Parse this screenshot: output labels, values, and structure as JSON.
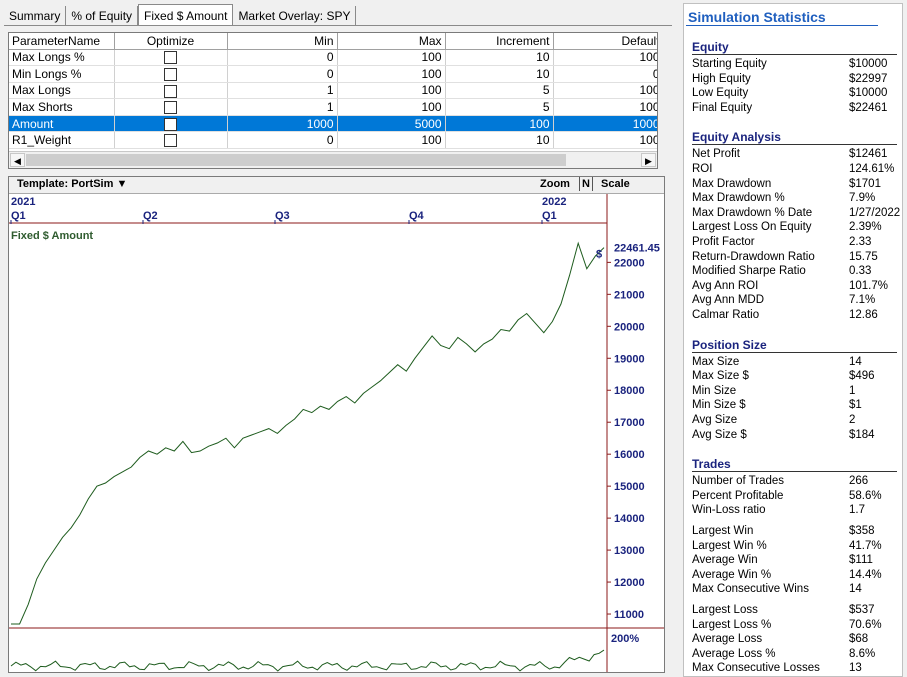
{
  "tabs": [
    "Summary",
    "% of Equity",
    "Fixed $ Amount",
    "Market Overlay: SPY"
  ],
  "active_tab": "Fixed $ Amount",
  "params": {
    "headers": [
      "ParameterName",
      "Optimize",
      "Min",
      "Max",
      "Increment",
      "Default"
    ],
    "rows": [
      {
        "name": "Max Longs %",
        "min": "0",
        "max": "100",
        "inc": "10",
        "def": "100"
      },
      {
        "name": "Min Longs %",
        "min": "0",
        "max": "100",
        "inc": "10",
        "def": "0"
      },
      {
        "name": "Max Longs",
        "min": "1",
        "max": "100",
        "inc": "5",
        "def": "100"
      },
      {
        "name": "Max Shorts",
        "min": "1",
        "max": "100",
        "inc": "5",
        "def": "100"
      },
      {
        "name": "Amount",
        "min": "1000",
        "max": "5000",
        "inc": "100",
        "def": "1000"
      },
      {
        "name": "R1_Weight",
        "min": "0",
        "max": "100",
        "inc": "10",
        "def": "100"
      }
    ],
    "selected_row": 4
  },
  "chart_toolbar": {
    "template": "Template: PortSim",
    "template_arrow": "▼",
    "zoom": "Zoom",
    "n": "N",
    "scale": "Scale"
  },
  "chart_data": {
    "type": "line",
    "years": [
      "2021",
      "2022"
    ],
    "quarters": [
      "Q1",
      "Q2",
      "Q3",
      "Q4",
      "Q1"
    ],
    "series_name": "Fixed $ Amount",
    "last_value": "22461.45",
    "last_marker": "$",
    "y_ticks": [
      11000,
      12000,
      13000,
      14000,
      15000,
      16000,
      17000,
      18000,
      19000,
      20000,
      21000,
      22000
    ],
    "ylim": [
      10000,
      23200
    ],
    "series": [
      10000,
      10600,
      11300,
      12100,
      12600,
      13000,
      13400,
      13700,
      14100,
      14600,
      15000,
      15100,
      15300,
      15450,
      15600,
      15900,
      16100,
      16000,
      16200,
      16100,
      16400,
      16050,
      16100,
      16250,
      16350,
      16500,
      16200,
      16500,
      16600,
      16700,
      16800,
      16650,
      16900,
      17100,
      17400,
      17300,
      17500,
      17400,
      17650,
      17800,
      17600,
      17900,
      18100,
      18300,
      18550,
      18800,
      18600,
      19000,
      19350,
      19700,
      19400,
      19300,
      19650,
      19450,
      19200,
      19450,
      19600,
      19900,
      19850,
      20200,
      20400,
      20100,
      19800,
      20150,
      20700,
      21600,
      22600,
      21800,
      22200,
      22461.45
    ],
    "sub_pane_label": "200%"
  },
  "stats": {
    "title": "Simulation Statistics",
    "sections": [
      {
        "title": "Equity",
        "rows": [
          [
            "Starting Equity",
            "$10000"
          ],
          [
            "High Equity",
            "$22997"
          ],
          [
            "Low Equity",
            "$10000"
          ],
          [
            "Final Equity",
            "$22461"
          ]
        ]
      },
      {
        "title": "Equity Analysis",
        "rows": [
          [
            "Net Profit",
            "$12461"
          ],
          [
            "ROI",
            "124.61%"
          ],
          [
            "Max Drawdown",
            "$1701"
          ],
          [
            "Max Drawdown %",
            "7.9%"
          ],
          [
            "Max Drawdown % Date",
            "1/27/2022"
          ],
          [
            "Largest Loss On Equity",
            "2.39%"
          ],
          [
            "Profit Factor",
            "2.33"
          ],
          [
            "Return-Drawdown Ratio",
            "15.75"
          ],
          [
            "Modified Sharpe Ratio",
            "0.33"
          ],
          [
            "Avg Ann ROI",
            "101.7%"
          ],
          [
            "Avg Ann MDD",
            "7.1%"
          ],
          [
            "Calmar Ratio",
            "12.86"
          ]
        ]
      },
      {
        "title": "Position Size",
        "rows": [
          [
            "Max Size",
            "14"
          ],
          [
            "Max Size $",
            "$496"
          ],
          [
            "Min Size",
            "1"
          ],
          [
            "Min Size $",
            "$1"
          ],
          [
            "Avg Size",
            "2"
          ],
          [
            "Avg Size $",
            "$184"
          ]
        ]
      },
      {
        "title": "Trades",
        "rows": [
          [
            "Number of Trades",
            "266"
          ],
          [
            "Percent Profitable",
            "58.6%"
          ],
          [
            "Win-Loss ratio",
            "1.7"
          ],
          [
            "Largest Win",
            "$358"
          ],
          [
            "Largest Win %",
            "41.7%"
          ],
          [
            "Average Win",
            "$111"
          ],
          [
            "Average Win %",
            "14.4%"
          ],
          [
            "Max Consecutive Wins",
            "14"
          ],
          [
            "Largest Loss",
            "$537"
          ],
          [
            "Largest Loss %",
            "70.6%"
          ],
          [
            "Average Loss",
            "$68"
          ],
          [
            "Average Loss %",
            "8.6%"
          ],
          [
            "Max Consecutive Losses",
            "13"
          ]
        ]
      }
    ]
  }
}
